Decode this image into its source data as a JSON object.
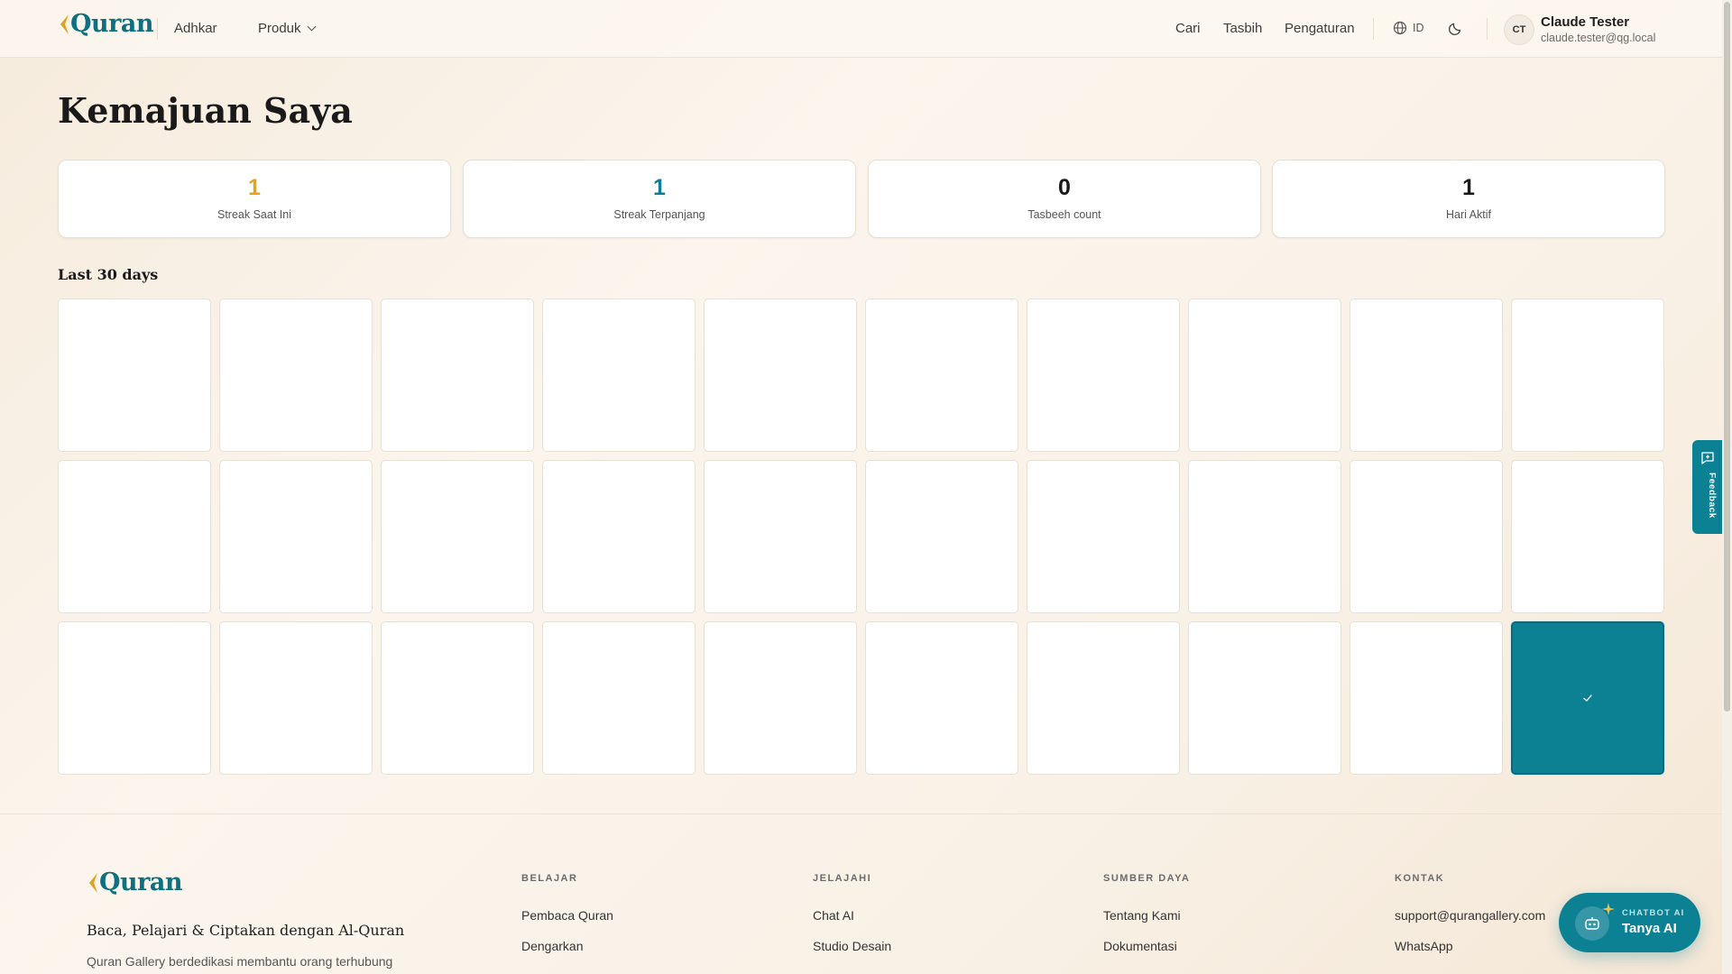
{
  "app": {
    "logo_text": "Quran"
  },
  "header": {
    "nav": {
      "adhkar": "Adhkar",
      "produk": "Produk"
    },
    "actions": {
      "cari": "Cari",
      "tasbih": "Tasbih",
      "pengaturan": "Pengaturan"
    },
    "language": "ID",
    "user": {
      "initials": "CT",
      "name": "Claude Tester",
      "email": "claude.tester@qg.local"
    }
  },
  "page": {
    "title": "Kemajuan Saya"
  },
  "stats": [
    {
      "value": "1",
      "label": "Streak Saat Ini",
      "color": "#e8a317"
    },
    {
      "value": "1",
      "label": "Streak Terpanjang",
      "color": "#0c8194"
    },
    {
      "value": "0",
      "label": "Tasbeeh count",
      "color": "#1a1a1a"
    },
    {
      "value": "1",
      "label": "Hari Aktif",
      "color": "#1a1a1a"
    }
  ],
  "calendar": {
    "title": "Last 30 days",
    "days_shown": 30,
    "active_days": [
      30
    ]
  },
  "feedback": {
    "label": "Feedback"
  },
  "footer": {
    "tagline": "Baca, Pelajari & Ciptakan dengan Al-Quran",
    "description": "Quran Gallery berdedikasi membantu orang terhubung",
    "columns": [
      {
        "heading": "BELAJAR",
        "links": [
          "Pembaca Quran",
          "Dengarkan"
        ]
      },
      {
        "heading": "JELAJAHI",
        "links": [
          "Chat AI",
          "Studio Desain"
        ]
      },
      {
        "heading": "SUMBER DAYA",
        "links": [
          "Tentang Kami",
          "Dokumentasi"
        ]
      },
      {
        "heading": "KONTAK",
        "links": [
          "support@qurangallery.com",
          "WhatsApp"
        ]
      }
    ]
  },
  "chatbot": {
    "sub_label": "CHATBOT AI",
    "label": "Tanya AI"
  },
  "colors": {
    "primary": "#0c8194",
    "accent": "#e8a317"
  }
}
